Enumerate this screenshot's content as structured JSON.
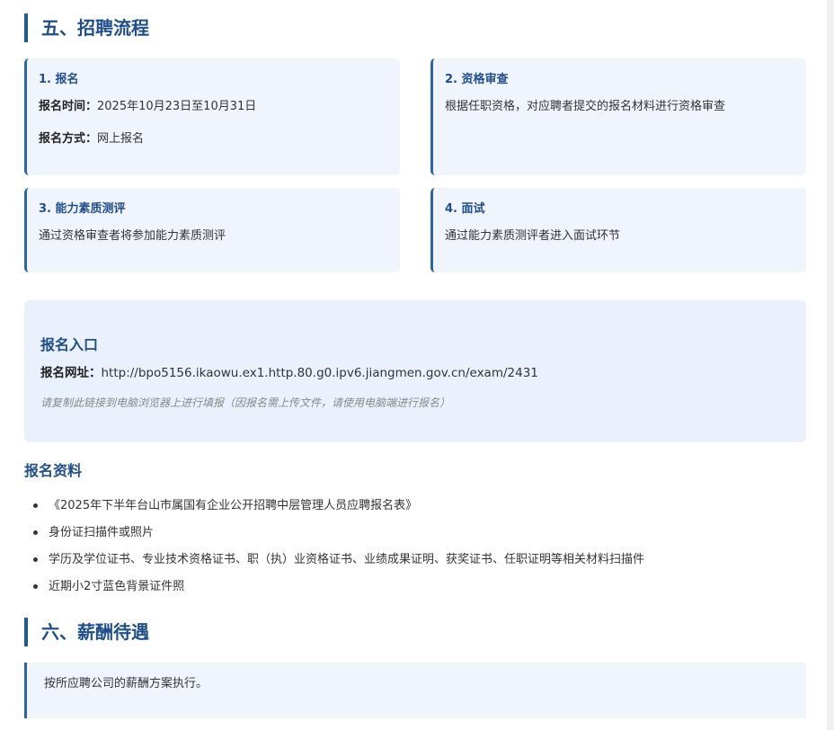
{
  "section5": {
    "title": "五、招聘流程"
  },
  "steps": [
    {
      "title": "1. 报名",
      "lines": [
        {
          "label": "报名时间：",
          "value": "2025年10月23日至10月31日"
        },
        {
          "label": "报名方式：",
          "value": "网上报名"
        }
      ]
    },
    {
      "title": "2. 资格审查",
      "lines": [
        {
          "label": "",
          "value": "根据任职资格，对应聘者提交的报名材料进行资格审查"
        }
      ]
    },
    {
      "title": "3. 能力素质测评",
      "lines": [
        {
          "label": "",
          "value": "通过资格审查者将参加能力素质测评"
        }
      ]
    },
    {
      "title": "4. 面试",
      "lines": [
        {
          "label": "",
          "value": "通过能力素质测评者进入面试环节"
        }
      ]
    }
  ],
  "entry": {
    "title": "报名入口",
    "url_label": "报名网址：",
    "url": "http://bpo5156.ikaowu.ex1.http.80.g0.ipv6.jiangmen.gov.cn/exam/2431",
    "note": "请复制此链接到电脑浏览器上进行填报（因报名需上传文件，请使用电脑端进行报名）"
  },
  "materials": {
    "title": "报名资料",
    "items": [
      "《2025年下半年台山市属国有企业公开招聘中层管理人员应聘报名表》",
      "身份证扫描件或照片",
      "学历及学位证书、专业技术资格证书、职（执）业资格证书、业绩成果证明、获奖证书、任职证明等相关材料扫描件",
      "近期小2寸蓝色背景证件照"
    ]
  },
  "section6": {
    "title": "六、薪酬待遇"
  },
  "salary": {
    "text": "按所应聘公司的薪酬方案执行。"
  }
}
